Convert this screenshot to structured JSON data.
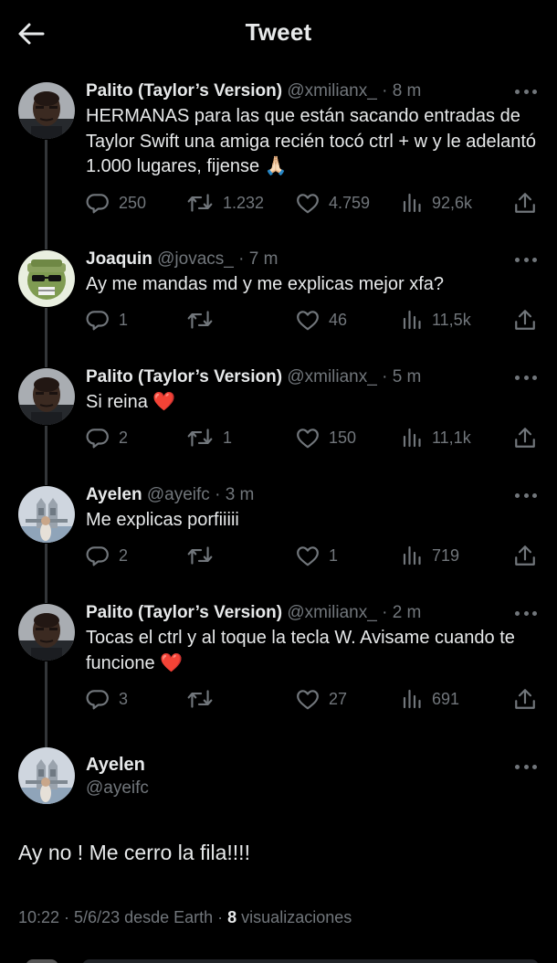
{
  "header": {
    "title": "Tweet"
  },
  "replies": [
    {
      "name": "Palito (Taylor’s Version)",
      "handle": "@xmilianx_",
      "time": "· 8 m",
      "text": "HERMANAS para las que están sacando entradas de Taylor Swift una amiga recién tocó ctrl + w y le adelantó 1.000 lugares, fijense 🙏🏻",
      "avatar": "palito",
      "replies": "250",
      "retweets": "1.232",
      "likes": "4.759",
      "views": "92,6k"
    },
    {
      "name": "Joaquin",
      "handle": "@jovacs_",
      "time": "· 7 m",
      "text": "Ay me mandas md y me explicas mejor xfa?",
      "avatar": "joaquin",
      "replies": "1",
      "retweets": "",
      "likes": "46",
      "views": "11,5k"
    },
    {
      "name": "Palito (Taylor’s Version)",
      "handle": "@xmilianx_",
      "time": "· 5 m",
      "text": "Si reina ❤️",
      "avatar": "palito",
      "replies": "2",
      "retweets": "1",
      "likes": "150",
      "views": "11,1k"
    },
    {
      "name": "Ayelen",
      "handle": "@ayeifc",
      "time": "· 3 m",
      "text": "Me explicas porfiiiii",
      "avatar": "ayelen",
      "replies": "2",
      "retweets": "",
      "likes": "1",
      "views": "719"
    },
    {
      "name": "Palito (Taylor’s Version)",
      "handle": "@xmilianx_",
      "time": "· 2 m",
      "text": "Tocas el ctrl y al toque la tecla W. Avisame cuando te funcione ❤️",
      "avatar": "palito",
      "replies": "3",
      "retweets": "",
      "likes": "27",
      "views": "691"
    }
  ],
  "main_tweet": {
    "name": "Ayelen",
    "handle": "@ayeifc",
    "text": "Ay no ! Me cerro la fila!!!!",
    "timestamp": "10:22 · 5/6/23 desde Earth · ",
    "views_count": "8",
    "views_label": " visualizaciones"
  },
  "colors": {
    "background": "#000000",
    "text": "#e7e9ea",
    "muted": "#71767b",
    "thread_line": "#333639"
  },
  "icons": [
    "back-arrow-icon",
    "more-icon",
    "reply-icon",
    "retweet-icon",
    "like-icon",
    "views-icon",
    "share-icon"
  ]
}
